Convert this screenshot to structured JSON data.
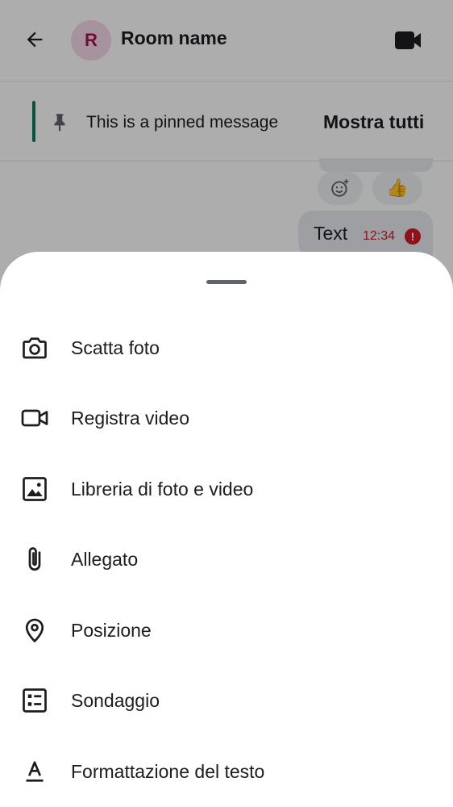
{
  "header": {
    "avatar_letter": "R",
    "room_name": "Room name"
  },
  "pinned": {
    "message": "This is a pinned message",
    "show_all_label": "Mostra tutti"
  },
  "timeline": {
    "message_text": "Text",
    "message_time": "12:34",
    "reaction": "👍",
    "error_symbol": "!"
  },
  "sheet": {
    "items": [
      {
        "label": "Scatta foto",
        "icon": "camera-icon"
      },
      {
        "label": "Registra video",
        "icon": "video-icon"
      },
      {
        "label": "Libreria di foto e video",
        "icon": "gallery-icon"
      },
      {
        "label": "Allegato",
        "icon": "paperclip-icon"
      },
      {
        "label": "Posizione",
        "icon": "location-pin-icon"
      },
      {
        "label": "Sondaggio",
        "icon": "poll-icon"
      },
      {
        "label": "Formattazione del testo",
        "icon": "text-format-icon"
      }
    ]
  },
  "colors": {
    "accent_green": "#0b7a5f",
    "avatar_bg": "#f7d9e7",
    "avatar_text": "#a41456",
    "error_red": "#d51928"
  }
}
